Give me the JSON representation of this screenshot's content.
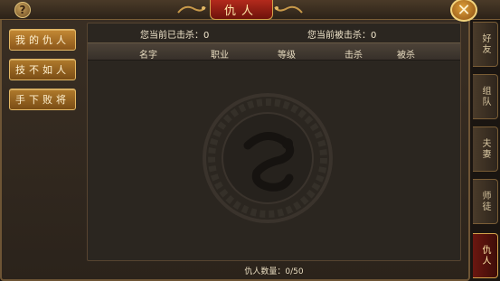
{
  "title": "仇人",
  "help_icon_label": "?",
  "close_icon_label": "✕",
  "left_nav": [
    {
      "label": "我的仇人"
    },
    {
      "label": "技不如人"
    },
    {
      "label": "手下败将"
    }
  ],
  "stats": {
    "kills": "您当前已击杀：0",
    "killed_by": "您当前被击杀：0"
  },
  "table": {
    "columns": [
      "名字",
      "职业",
      "等级",
      "击杀",
      "被杀"
    ]
  },
  "footer": {
    "count": "仇人数量：0/50"
  },
  "side_tabs": [
    {
      "label": "好友",
      "active": false
    },
    {
      "label": "组队",
      "active": false
    },
    {
      "label": "夫妻",
      "active": false
    },
    {
      "label": "师徒",
      "active": false
    },
    {
      "label": "仇人",
      "active": true
    }
  ],
  "colors": {
    "accent_red": "#b32a1c",
    "gold": "#d2a24a",
    "panel": "#2b2620"
  }
}
